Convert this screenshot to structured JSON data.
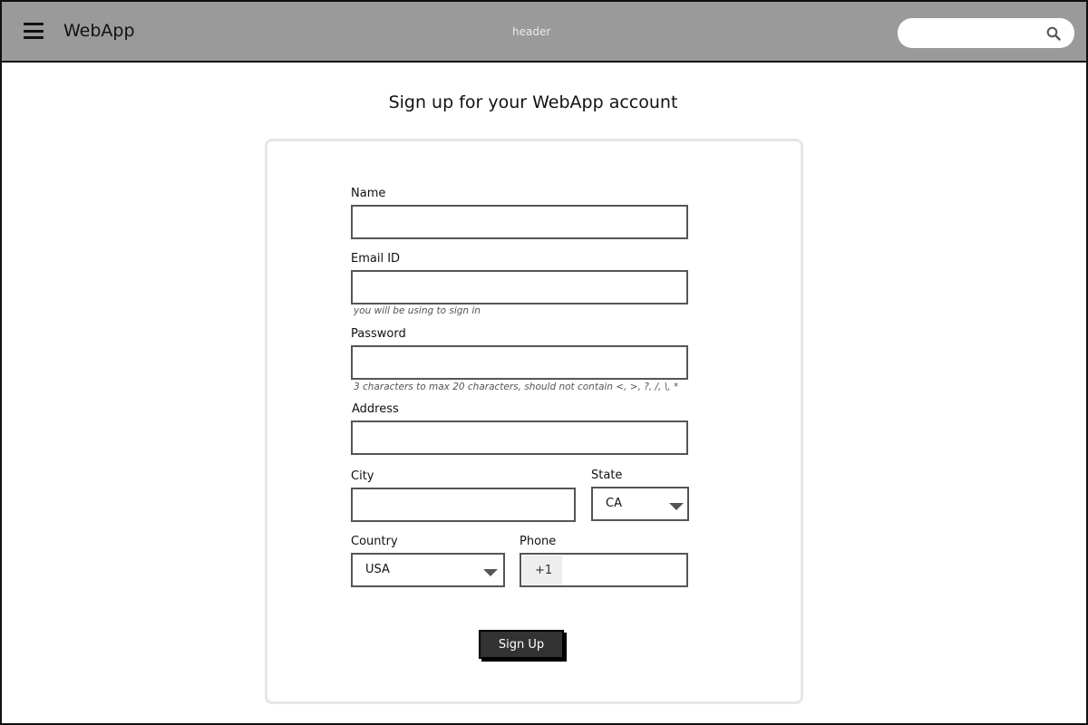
{
  "header": {
    "brand": "WebApp",
    "label": "header",
    "search_placeholder": "",
    "icons": {
      "menu": "hamburger-menu-icon",
      "search": "magnifier-search-icon"
    }
  },
  "page": {
    "title": "Sign up for your WebApp account"
  },
  "form": {
    "name_label": "Name",
    "name_value": "",
    "email_label": "Email ID",
    "email_value": "",
    "email_hint": "you will be using to sign in",
    "password_label": "Password",
    "password_value": "",
    "password_hint": "3 characters to max 20 characters, should not contain <, >, ?, /, \\, *",
    "address_label": "Address",
    "address_value": "",
    "city_label": "City",
    "city_value": "",
    "state_label": "State",
    "state_value": "CA",
    "country_label": "Country",
    "country_value": "USA",
    "phone_label": "Phone",
    "phone_prefix": "+1",
    "phone_value": "",
    "submit_label": "Sign Up"
  },
  "colors": {
    "header_bg": "#9a9a9a",
    "button_bg": "#333333",
    "card_border": "#e6e6e6"
  }
}
